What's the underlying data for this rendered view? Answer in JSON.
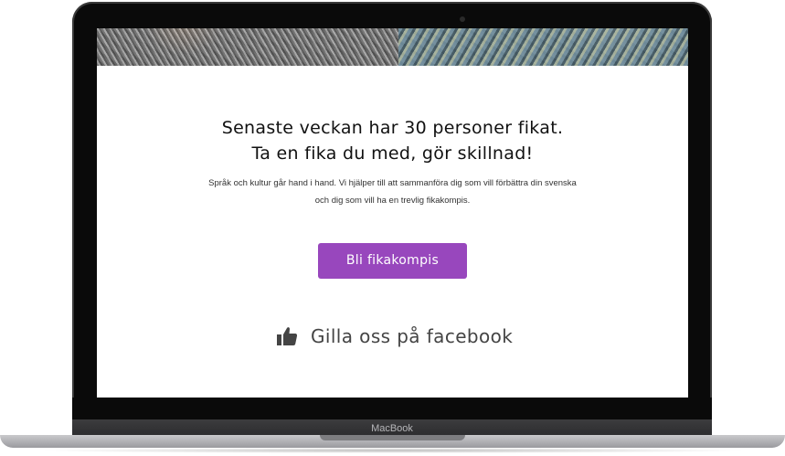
{
  "device": {
    "brand_label": "MacBook"
  },
  "hero": {
    "headline_line1": "Senaste veckan har 30 personer fikat.",
    "headline_line2": "Ta en fika du med, gör skillnad!"
  },
  "intro": {
    "line1": "Språk och kultur går hand i hand. Vi hjälper till att sammanföra dig som vill förbättra din svenska",
    "line2": "och dig som vill ha en trevlig fikakompis."
  },
  "cta": {
    "label": "Bli fikakompis",
    "color": "#9847bd"
  },
  "facebook": {
    "label": "Gilla oss på facebook",
    "icon": "thumbs-up-icon"
  }
}
